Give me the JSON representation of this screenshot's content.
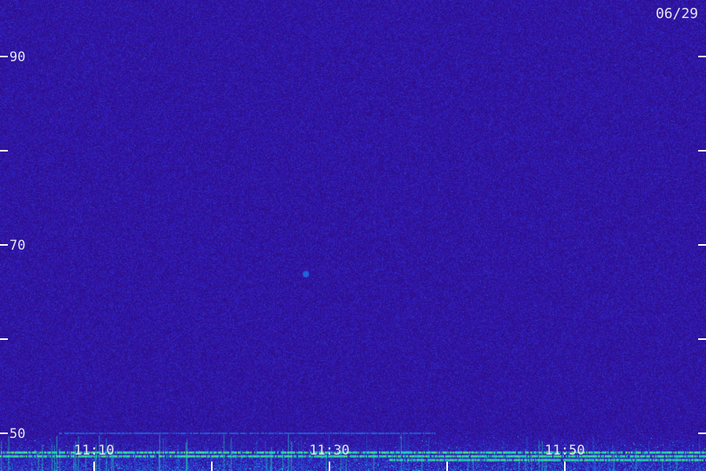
{
  "chart_data": {
    "type": "heatmap",
    "title": "",
    "xlabel": "",
    "ylabel": "",
    "date_label": "06/29",
    "y_axis": {
      "range": [
        46,
        96
      ],
      "labeled_ticks": [
        "90",
        "70",
        "50"
      ],
      "minor_ticks": [
        80,
        60
      ]
    },
    "x_axis": {
      "range": [
        "11:02",
        "11:62"
      ],
      "tick_labels": [
        "11:10",
        "11:30",
        "11:50"
      ],
      "tick_positions": [
        10,
        20,
        30,
        40,
        50
      ]
    },
    "features": [
      {
        "label": "",
        "kind": "band",
        "y": 50,
        "x_start": "11:07",
        "x_end": "11:39",
        "intensity": "medium"
      },
      {
        "label": "",
        "kind": "band",
        "y": 48.0,
        "x_start": "11:02",
        "x_end": "11:62",
        "intensity": "high"
      },
      {
        "label": "",
        "kind": "band",
        "y": 47.6,
        "x_start": "11:02",
        "x_end": "11:62",
        "intensity": "high"
      },
      {
        "label": "",
        "kind": "band",
        "y": 47.2,
        "x_start": "11:35",
        "x_end": "11:62",
        "intensity": "high"
      },
      {
        "label": "",
        "kind": "blob",
        "y": 66.9,
        "x": "11:28",
        "intensity": "medium"
      },
      {
        "label": "",
        "kind": "segment",
        "y": 66.9,
        "x_start": "11:58.5",
        "x_end": "11:61",
        "intensity": "low"
      },
      {
        "label": "",
        "kind": "band",
        "y": 92.8,
        "x_start": "11:02",
        "x_end": "11:62",
        "intensity": "low"
      },
      {
        "label": "",
        "kind": "band",
        "y": 81.3,
        "x_start": "11:02",
        "x_end": "11:62",
        "intensity": "low"
      },
      {
        "label": "",
        "kind": "band",
        "y": 62.5,
        "x_start": "11:02",
        "x_end": "11:62",
        "intensity": "low"
      }
    ],
    "colors": {
      "background": "#2a0a78",
      "low": "#3418b8",
      "medium": "#1f6be0",
      "high": "#22e6b4",
      "peak": "#b8ff3a"
    },
    "grid": false,
    "legend": "none"
  }
}
